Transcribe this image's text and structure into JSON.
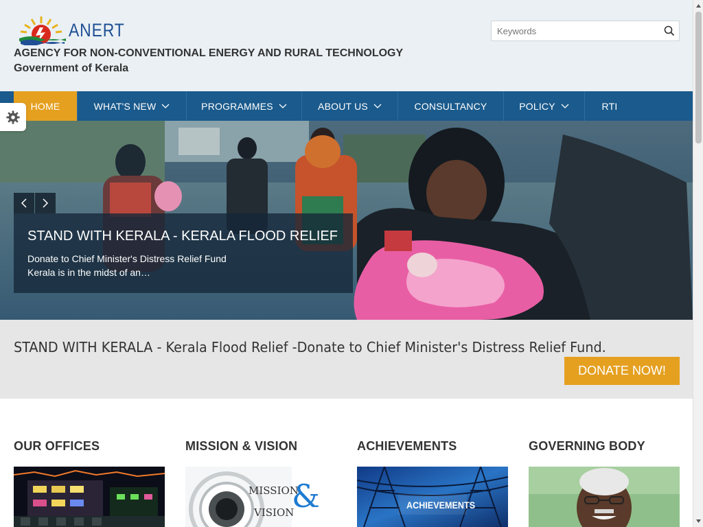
{
  "header": {
    "logo_text": "ANERT",
    "org_name": "AGENCY FOR NON-CONVENTIONAL ENERGY AND RURAL TECHNOLOGY",
    "org_sub": "Government of Kerala",
    "search_placeholder": "Keywords"
  },
  "nav": {
    "items": [
      {
        "label": "HOME",
        "active": true
      },
      {
        "label": "WHAT'S NEW",
        "dropdown": true
      },
      {
        "label": "PROGRAMMES",
        "dropdown": true
      },
      {
        "label": "ABOUT US",
        "dropdown": true
      },
      {
        "label": "CONSULTANCY"
      },
      {
        "label": "POLICY",
        "dropdown": true
      },
      {
        "label": "RTI"
      }
    ]
  },
  "hero": {
    "title": "STAND WITH KERALA - KERALA FLOOD RELIEF",
    "line1": "Donate to Chief Minister's Distress Relief Fund",
    "line2": "Kerala is in the midst of an…"
  },
  "banner": {
    "text": "STAND WITH KERALA - Kerala Flood Relief -Donate to Chief Minister's Distress Relief Fund.",
    "button": "DONATE NOW!"
  },
  "sections": [
    {
      "title": "OUR OFFICES"
    },
    {
      "title": "MISSION & VISION",
      "image_text_1": "MISSION",
      "image_text_2": "VISION",
      "image_amp": "&"
    },
    {
      "title": "ACHIEVEMENTS",
      "image_text": "ACHIEVEMENTS"
    },
    {
      "title": "GOVERNING BODY"
    }
  ],
  "colors": {
    "header_bg": "#eaf0f4",
    "nav_bg": "#1a5a8c",
    "accent": "#e5a020",
    "banner_bg": "#e6e6e6"
  }
}
